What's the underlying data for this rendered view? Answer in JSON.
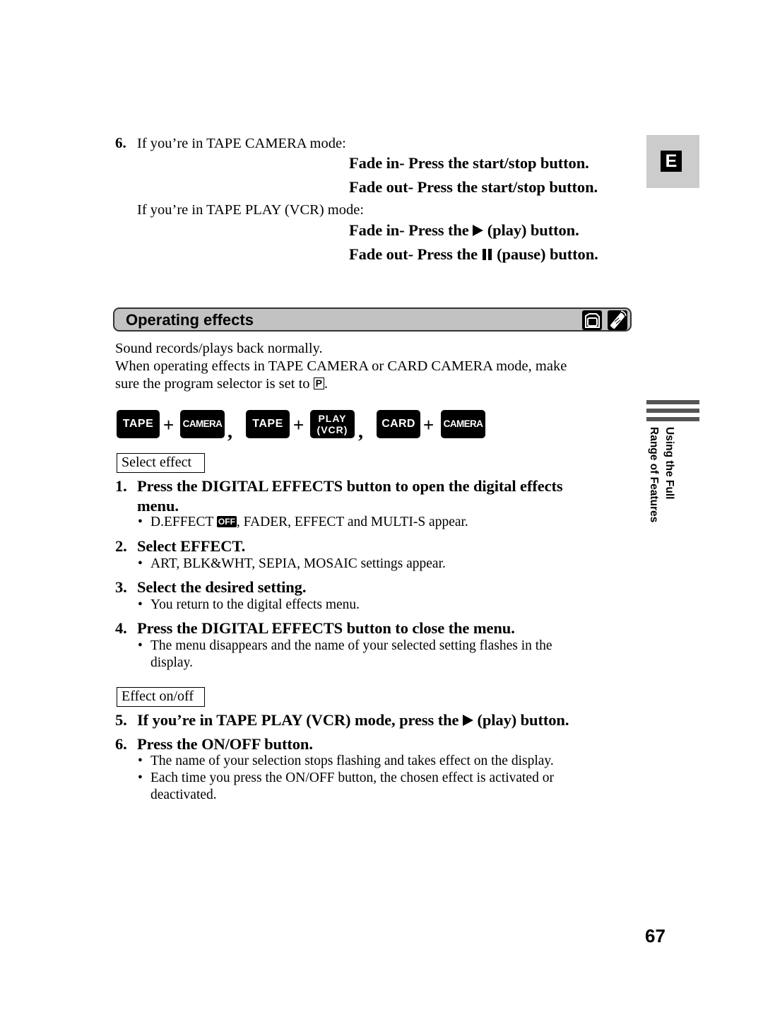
{
  "fade_section": {
    "step_number": "6.",
    "tape_camera_intro": "If you’re in TAPE CAMERA mode:",
    "tape_camera_fade_in": "Fade in- Press the start/stop button.",
    "tape_camera_fade_out": "Fade out- Press the start/stop button.",
    "tape_play_intro": "If you’re in TAPE PLAY (VCR) mode:",
    "tape_play_fade_in_prefix": "Fade in- Press the",
    "tape_play_fade_in_suffix": "(play) button.",
    "tape_play_fade_out_prefix": "Fade out- Press the",
    "tape_play_fade_out_suffix": "(pause) button.",
    "play_icon": "play-icon",
    "pause_icon": "pause-icon"
  },
  "language_tab": {
    "letter": "E"
  },
  "section": {
    "title": "Operating effects",
    "icons": [
      "camcorder-icon",
      "remote-control-icon"
    ],
    "intro_line1": "Sound records/plays back normally.",
    "intro_line2": "When operating effects in TAPE CAMERA or CARD CAMERA mode, make",
    "intro_line3_prefix": "sure the program selector is set to",
    "program_symbol": "P",
    "intro_line3_suffix": "."
  },
  "mode_chips": {
    "groups": [
      {
        "first": "TAPE",
        "second": "CAMERA"
      },
      {
        "first": "TAPE",
        "second_line1": "PLAY",
        "second_line2": "(VCR)"
      },
      {
        "first": "CARD",
        "second": "CAMERA"
      }
    ],
    "plus": "+",
    "comma": ","
  },
  "select_effect": {
    "label": "Select effect",
    "steps": [
      {
        "number": "1.",
        "line1": "Press the DIGITAL EFFECTS button to open the digital effects",
        "line2": "menu.",
        "bullet_prefix": "D.EFFECT",
        "bullet_badge": "OFF",
        "bullet_suffix": ", FADER, EFFECT and MULTI-S appear."
      },
      {
        "number": "2.",
        "text": "Select EFFECT.",
        "bullet": "ART, BLK&WHT, SEPIA, MOSAIC settings appear."
      },
      {
        "number": "3.",
        "text": "Select the desired setting.",
        "bullet": "You return to the digital effects menu."
      },
      {
        "number": "4.",
        "text": "Press the DIGITAL EFFECTS button to close the menu.",
        "bullet_line1": "The menu disappears and the name of your selected setting flashes in the",
        "bullet_line2": "display."
      }
    ]
  },
  "effect_onoff": {
    "label": "Effect on/off",
    "steps": [
      {
        "number": "5.",
        "text_prefix": "If you’re in TAPE PLAY (VCR) mode, press the",
        "text_suffix": "(play) button."
      },
      {
        "number": "6.",
        "text": "Press the ON/OFF button.",
        "bullet1": "The name of your selection stops flashing and takes effect on the display.",
        "bullet2_line1": "Each time you press the ON/OFF button, the chosen effect is activated or",
        "bullet2_line2": "deactivated."
      }
    ]
  },
  "side_tab": {
    "line1": "Using the Full",
    "line2": "Range of Features"
  },
  "bullet_char": "•",
  "page_number": "67"
}
